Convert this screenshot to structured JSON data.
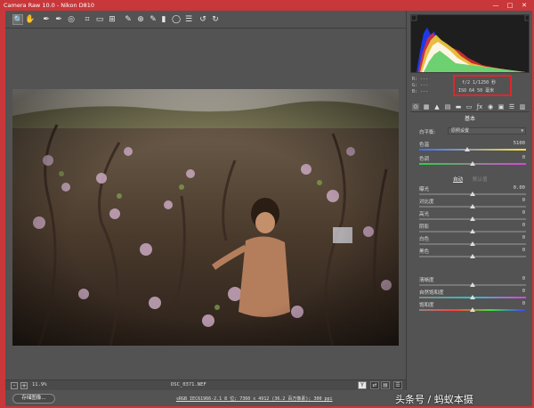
{
  "window": {
    "title": "Camera Raw 10.0 - Nikon D810",
    "minimize": "—",
    "maximize": "□",
    "close": "✕"
  },
  "toolbar": {
    "tools": [
      {
        "name": "zoom-tool-icon",
        "glyph": "🔍"
      },
      {
        "name": "hand-tool-icon",
        "glyph": "✋"
      },
      {
        "name": "white-balance-tool-icon",
        "glyph": "✒"
      },
      {
        "name": "color-sampler-tool-icon",
        "glyph": "✒"
      },
      {
        "name": "targeted-adjustment-tool-icon",
        "glyph": "◎"
      },
      {
        "name": "crop-tool-icon",
        "glyph": "⌗"
      },
      {
        "name": "straighten-tool-icon",
        "glyph": "▭"
      },
      {
        "name": "transform-tool-icon",
        "glyph": "⊞"
      },
      {
        "name": "spot-removal-tool-icon",
        "glyph": "✎"
      },
      {
        "name": "red-eye-tool-icon",
        "glyph": "⊕"
      },
      {
        "name": "adjustment-brush-icon",
        "glyph": "✎"
      },
      {
        "name": "graduated-filter-icon",
        "glyph": "▮"
      },
      {
        "name": "radial-filter-icon",
        "glyph": "◯"
      },
      {
        "name": "preferences-icon",
        "glyph": "☰"
      },
      {
        "name": "rotate-left-icon",
        "glyph": "↺"
      },
      {
        "name": "rotate-right-icon",
        "glyph": "↻"
      }
    ]
  },
  "canvas": {
    "zoom_out": "-",
    "zoom_in": "+",
    "zoom_level": "11.9%",
    "filename": "DSC_0371.NEF",
    "view_y": "Y"
  },
  "footer": {
    "save_label": "存储图像...",
    "workflow": "sRGB IEC61966-2.1 8 位; 7360 x 4912 (36.2 百万像素); 300 ppi"
  },
  "exif": {
    "r_label": "R:",
    "g_label": "G:",
    "b_label": "B:",
    "r_val": "---",
    "g_val": "---",
    "b_val": "---",
    "aperture_shutter": "f/2  1/1250 秒",
    "iso_focal": "ISO 64  50 毫米"
  },
  "panel": {
    "section": "基本",
    "wb_label": "白平衡:",
    "wb_value": "原照设置",
    "auto": "自动",
    "default": "默认值",
    "sliders": [
      {
        "label": "色温",
        "value": "5100",
        "pos": 0.45
      },
      {
        "label": "色调",
        "value": "0",
        "pos": 0.5
      },
      {
        "label": "曝光",
        "value": "0.00",
        "pos": 0.5
      },
      {
        "label": "对比度",
        "value": "0",
        "pos": 0.5
      },
      {
        "label": "高光",
        "value": "0",
        "pos": 0.5
      },
      {
        "label": "阴影",
        "value": "0",
        "pos": 0.5
      },
      {
        "label": "白色",
        "value": "0",
        "pos": 0.5
      },
      {
        "label": "黑色",
        "value": "0",
        "pos": 0.5
      },
      {
        "label": "清晰度",
        "value": "0",
        "pos": 0.5
      },
      {
        "label": "自然饱和度",
        "value": "0",
        "pos": 0.5
      },
      {
        "label": "饱和度",
        "value": "0",
        "pos": 0.5
      }
    ]
  },
  "watermark": "头条号 / 蚂蚁本摄"
}
